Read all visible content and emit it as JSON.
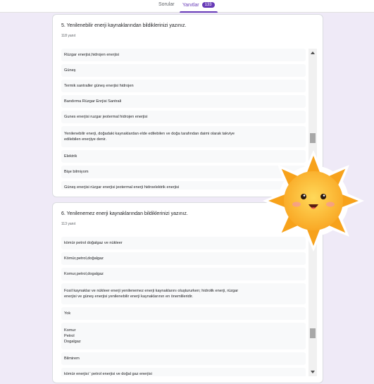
{
  "tabs": {
    "questions": "Sorular",
    "responses": "Yanıtlar",
    "responses_count": "133"
  },
  "questions": [
    {
      "title": "5. Yenilenebilir enerji kaynaklarından bildiklerinizi yazınız.",
      "count": "118 yanıt",
      "answers": [
        [
          "Rüzgar enerjisi,hidrojen enerjisi"
        ],
        [
          "Güneş"
        ],
        [
          "Termik santraller güneş enerjisi hidrojen"
        ],
        [
          "Bandırma Rüzgar Enrjisi Santrali"
        ],
        [
          "Gunes enerjisi ruzgar jeotermal hidrojen enerjisi"
        ],
        [
          "Yenilenebilir enerji, doğadaki kaynaklardan elde edilebilen ve doğa tarafından daimi olarak takviye",
          "edilebilen enerjiye denir."
        ],
        [
          "Elektrik"
        ],
        [
          "Bişe bilmiyom"
        ],
        [
          "Güneş enerjisi rüzgar enerjisi jeotermal enerji hidroelektrik enerjisi"
        ]
      ]
    },
    {
      "title": "6. Yenilenemez enerji kaynaklarından bildiklerinizi yazınız.",
      "count": "113 yanıt",
      "answers": [
        [
          "kömür petrol doğalgaz ve nükleer"
        ],
        [
          "Kömür,petrol,doğalgaz"
        ],
        [
          "Komur,petrol,dogalgaz"
        ],
        [
          "Fosil kaynaklar ve nükleer enerji yenilenemez enerji kaynaklarını oluştururken; hidrolik enerji, rüzgar",
          "enerjisi ve güneş enerjisi yenilenebilir enerji kaynaklarının en önemlileridir."
        ],
        [
          "Yok"
        ],
        [
          "Komur",
          "Petrol",
          "Dogalgaz"
        ],
        [
          "Bilmirem"
        ],
        [
          "kömür enerjisi ' petrol enerjisi ve doğal gaz enerjisi"
        ]
      ]
    }
  ]
}
